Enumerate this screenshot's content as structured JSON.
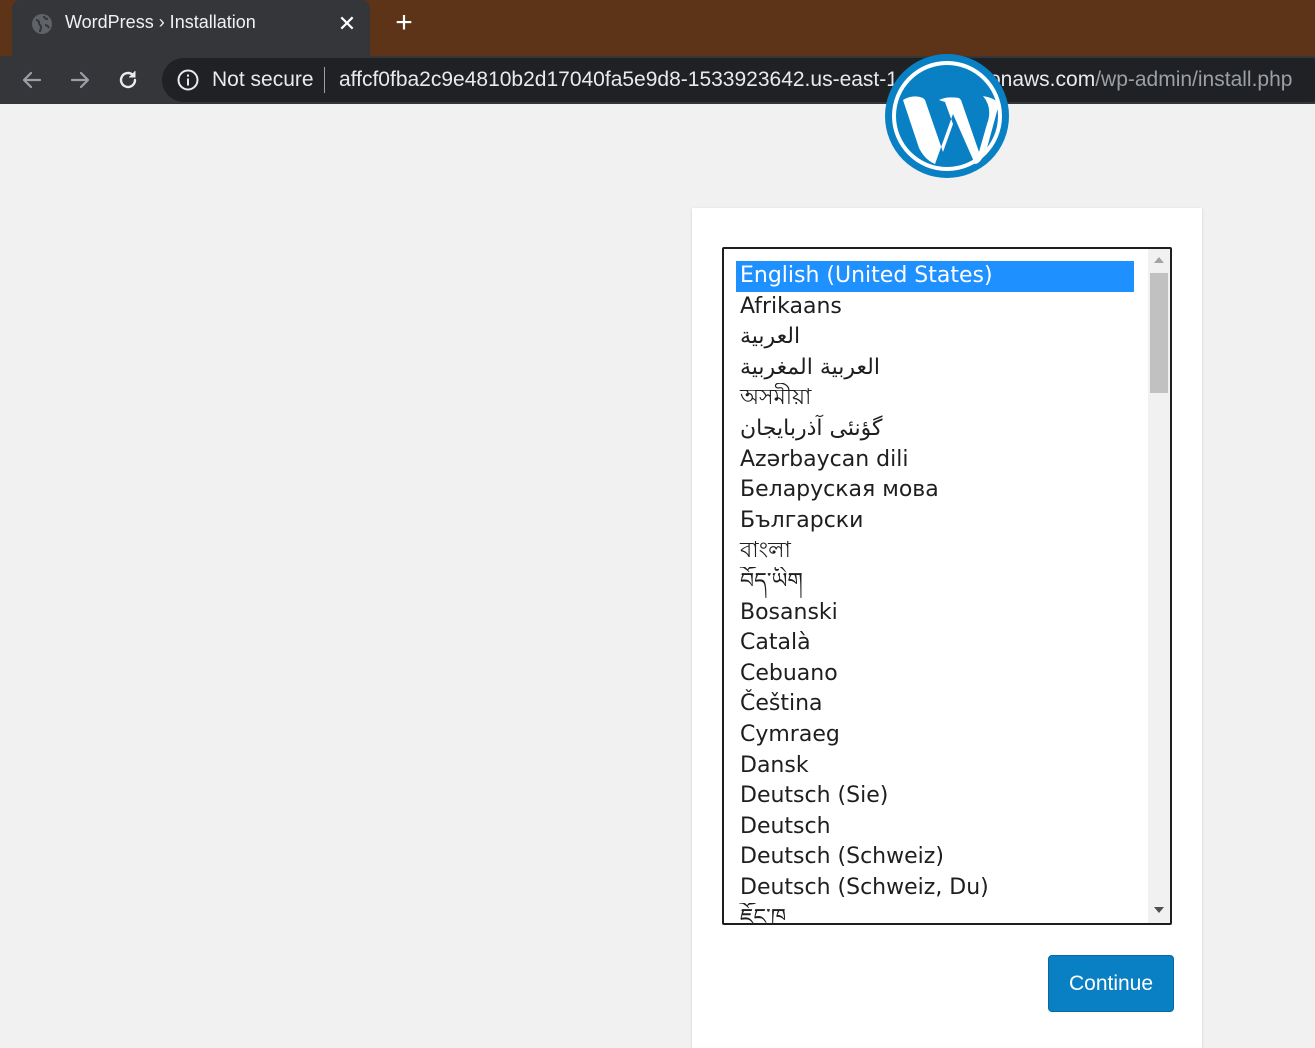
{
  "browser": {
    "tab": {
      "title": "WordPress › Installation",
      "close_glyph": "✕",
      "favicon": "globe-icon"
    },
    "new_tab_glyph": "+",
    "nav": {
      "back": "arrow-left-icon",
      "forward": "arrow-right-icon",
      "reload": "reload-icon"
    },
    "omnibox": {
      "security_label": "Not secure",
      "url_host": "affcf0fba2c9e4810b2d17040fa5e9d8-1533923642.us-east-1.elb.amazonaws.com",
      "url_path": "/wp-admin/install.php"
    },
    "colors": {
      "tabstrip": "#5e3418",
      "toolbar": "#35363a",
      "omnibox": "#202124"
    }
  },
  "page": {
    "logo": "wordpress-logo",
    "language_select": {
      "selected": "English (United States)",
      "options": [
        "English (United States)",
        "Afrikaans",
        "العربية",
        "العربية المغربية",
        "অসমীয়া",
        "گؤنئی آذربایجان",
        "Azərbaycan dili",
        "Беларуская мова",
        "Български",
        "বাংলা",
        "བོད་ཡིག",
        "Bosanski",
        "Català",
        "Cebuano",
        "Čeština",
        "Cymraeg",
        "Dansk",
        "Deutsch (Sie)",
        "Deutsch",
        "Deutsch (Schweiz)",
        "Deutsch (Schweiz, Du)",
        "ཇོང་ཁ"
      ]
    },
    "continue_label": "Continue",
    "colors": {
      "selected_option": "#1e90ff",
      "button": "#0a80c4",
      "background": "#f1f1f1"
    }
  }
}
